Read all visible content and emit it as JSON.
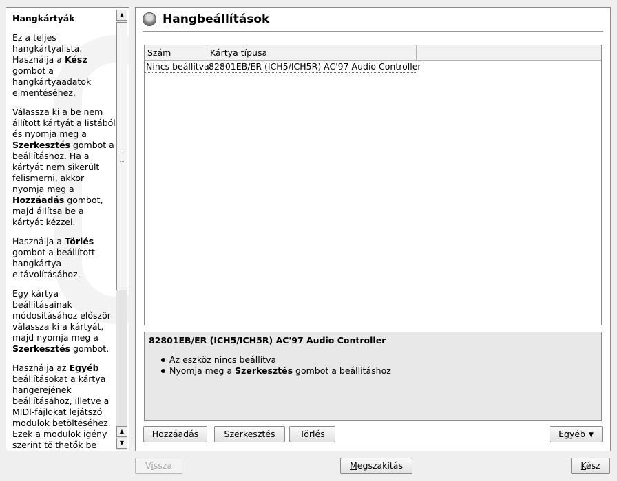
{
  "help": {
    "title": "Hangkártyák",
    "paragraphs": [
      [
        {
          "t": "Ez a teljes hangkártyalista. Használja a "
        },
        {
          "b": "Kész"
        },
        {
          "t": " gombot a hangkártyaadatok elmentéséhez."
        }
      ],
      [
        {
          "t": "Válassza ki a be nem állított kártyát a listából és nyomja meg a "
        },
        {
          "b": "Szerkesztés"
        },
        {
          "t": " gombot a beállításhoz. Ha a kártyát nem sikerült felismerni, akkor nyomja meg a "
        },
        {
          "b": "Hozzáadás"
        },
        {
          "t": " gombot, majd állítsa be a kártyát kézzel."
        }
      ],
      [
        {
          "t": "Használja a "
        },
        {
          "b": "Törlés"
        },
        {
          "t": " gombot a beállított hangkártya eltávolításához."
        }
      ],
      [
        {
          "t": "Egy kártya beállításainak módosításához először válassza ki a kártyát, majd nyomja meg a "
        },
        {
          "b": "Szerkesztés"
        },
        {
          "t": " gombot."
        }
      ],
      [
        {
          "t": "Használja az "
        },
        {
          "b": "Egyéb"
        },
        {
          "t": " beállításokat a kártya hangerejének beállításához, illetve a MIDI-fájlokat lejátszó modulok betöltéséhez. Ezek a modulok igény szerint tölthetők be"
        }
      ]
    ]
  },
  "main": {
    "title": "Hangbeállítások",
    "table": {
      "columns": [
        "Szám",
        "Kártya típusa"
      ],
      "rows": [
        [
          "Nincs beállítva",
          "82801EB/ER (ICH5/ICH5R) AC'97 Audio Controller"
        ]
      ]
    },
    "info": {
      "title": "82801EB/ER (ICH5/ICH5R) AC'97 Audio Controller",
      "items": [
        [
          {
            "t": "Az eszköz nincs beállítva"
          }
        ],
        [
          {
            "t": "Nyomja meg a "
          },
          {
            "b": "Szerkesztés"
          },
          {
            "t": " gombot a beállításhoz"
          }
        ]
      ]
    },
    "buttons": {
      "add": {
        "pre": "",
        "ul": "H",
        "post": "ozzáadás"
      },
      "edit": {
        "pre": "",
        "ul": "S",
        "post": "zerkesztés"
      },
      "delete": {
        "pre": "Tö",
        "ul": "r",
        "post": "lés"
      },
      "more": {
        "pre": "",
        "ul": "E",
        "post": "gyéb"
      }
    }
  },
  "footer": {
    "back": {
      "pre": "V",
      "ul": "i",
      "post": "ssza"
    },
    "cancel": {
      "pre": "",
      "ul": "M",
      "post": "egszakítás"
    },
    "ok": {
      "pre": "",
      "ul": "K",
      "post": "ész"
    }
  },
  "icons": {
    "help_scroll_up": "arrow-up-icon",
    "help_scroll_down": "arrow-down-icon",
    "header": "disk-icon",
    "more_dropdown": "caret-down-icon"
  }
}
